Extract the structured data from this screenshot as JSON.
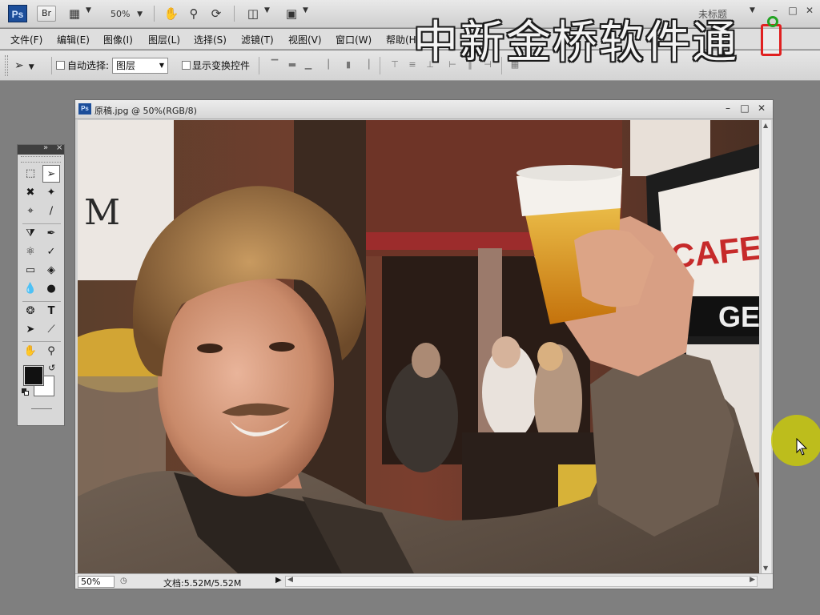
{
  "appbar": {
    "logo": "Ps",
    "bridge": "Br",
    "zoom": "50%",
    "doc_title": "未标题",
    "window_controls": [
      "minimize",
      "maximize",
      "close"
    ]
  },
  "menu": [
    "文件(F)",
    "编辑(E)",
    "图像(I)",
    "图层(L)",
    "选择(S)",
    "滤镜(T)",
    "视图(V)",
    "窗口(W)",
    "帮助(H)"
  ],
  "options": {
    "auto_select_label": "自动选择:",
    "auto_select_value": "图层",
    "show_transform_label": "显示变换控件"
  },
  "watermark": "中新金桥软件通",
  "toolbox": {
    "tools": [
      "marquee-tool",
      "move-tool",
      "lasso-tool",
      "magic-wand-tool",
      "crop-tool",
      "eyedropper-tool",
      "healing-brush-tool",
      "brush-tool",
      "clone-stamp-tool",
      "history-brush-tool",
      "eraser-tool",
      "paint-bucket-tool",
      "blur-tool",
      "dodge-tool",
      "pen-tool",
      "type-tool",
      "path-selection-tool",
      "line-tool",
      "hand-tool",
      "zoom-tool"
    ],
    "foreground": "#111111",
    "background": "#ffffff"
  },
  "document": {
    "logo": "Ps",
    "title": "原稿.jpg @ 50%(RGB/8)",
    "zoom": "50%",
    "doc_info": "文档:5.52M/5.52M",
    "sign_text_1": "CAFE",
    "sign_text_2": "GE",
    "left_sign": "M"
  }
}
